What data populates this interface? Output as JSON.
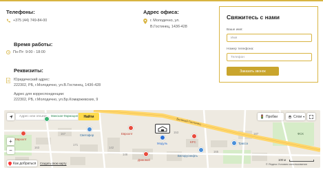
{
  "phones": {
    "title": "Телефоны:",
    "number": "+375 (44) 749-84-00"
  },
  "office": {
    "title": "Адрес офиса:",
    "line1": "г. Молодечно, ул.",
    "line2": "В.Гостинец, 143б-428"
  },
  "hours": {
    "title": "Время работы:",
    "value": "Пн-Пт: 9:00 - 18:00"
  },
  "requisites": {
    "title": "Реквизиты:",
    "legal_label": "Юридический адрес:",
    "legal_value": "222302, РБ, г.Молодечно, ул.В.Гостинец, 143б-428",
    "postal_label": "Адрес для корреспонденции:",
    "postal_value": "222302, РБ, г.Молодечно, ул.Бр.Комаржевских, 9"
  },
  "form": {
    "title": "Свяжитесь с нами",
    "name_label": "Ваше имя:",
    "name_placeholder": "Имя",
    "phone_label": "Номер телефона:",
    "phone_placeholder": "Телефон",
    "submit_label": "Заказать звонок"
  },
  "map": {
    "search_placeholder": "Адрес или объект",
    "find_label": "Найти",
    "traffic_label": "Пробки",
    "layers_label": "Слои",
    "street_label": "Великий Гостинец",
    "places": {
      "pharmacy": "Минская Фармация",
      "evroopt": "Евроопт",
      "svetofor": "Светофор",
      "evroopt2": "Евроопт",
      "modul": "Модуль",
      "kfc": "KFC",
      "belarusneft": "Белоруснефть",
      "trassa": "Трасса",
      "domovoy": "Домовой",
      "fsk": "ФСК"
    },
    "house_numbers": [
      "167",
      "171",
      "142",
      "163",
      "165",
      "187",
      "153",
      "146"
    ],
    "route_label": "Как добраться",
    "create_label": "Создать свою карту",
    "copyright": "© Яндекс Условия использования",
    "scale_label": "100 м",
    "zoom_in": "+",
    "zoom_out": "−"
  },
  "colors": {
    "accent": "#d8b441",
    "button": "#c9a52d",
    "find": "#ffdb4d",
    "road": "#ffd66b"
  }
}
